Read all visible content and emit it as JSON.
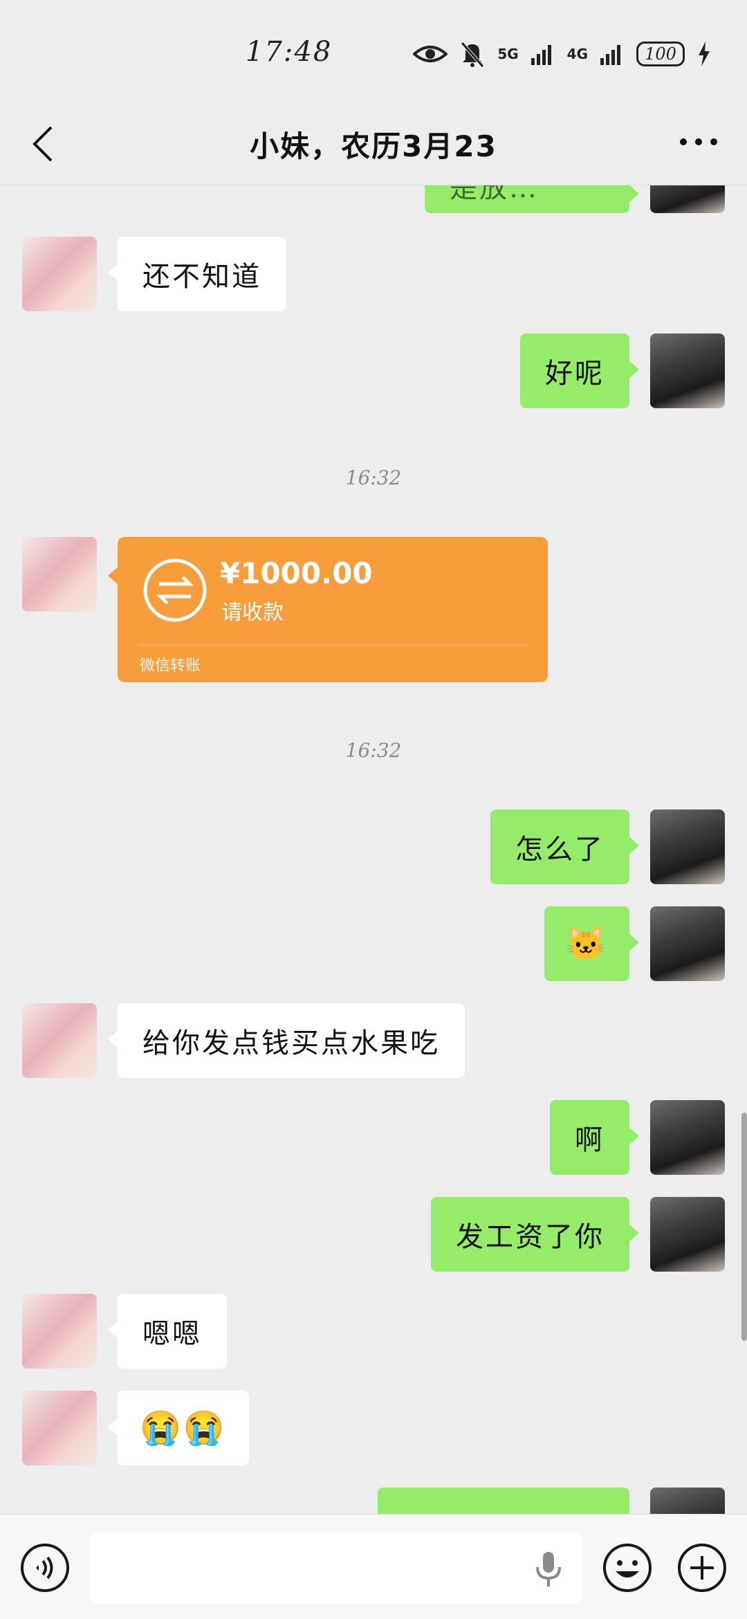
{
  "status_bar": {
    "time": "17:48",
    "network_1": "5G",
    "network_2": "4G",
    "battery": "100"
  },
  "header": {
    "title": "小妹，农历3月23",
    "back_icon": "chevron-left-icon",
    "more_icon": "more-dots-icon"
  },
  "messages": [
    {
      "side": "right",
      "text": "是放…",
      "partial": true
    },
    {
      "side": "left",
      "text": "还不知道"
    },
    {
      "side": "right",
      "text": "好呢"
    },
    {
      "type": "timestamp",
      "text": "16:32"
    },
    {
      "side": "left",
      "type": "transfer",
      "amount": "¥1000.00",
      "status": "请收款",
      "footer": "微信转账"
    },
    {
      "type": "timestamp",
      "text": "16:32"
    },
    {
      "side": "right",
      "text": "怎么了"
    },
    {
      "side": "right",
      "text": "🐱",
      "emoji": "smirk-dog-emoji"
    },
    {
      "side": "left",
      "text": "给你发点钱买点水果吃"
    },
    {
      "side": "right",
      "text": "啊"
    },
    {
      "side": "right",
      "text": "发工资了你"
    },
    {
      "side": "left",
      "text": "嗯嗯"
    },
    {
      "side": "left",
      "text": "😭😭",
      "emoji": "crying-emoji"
    },
    {
      "side": "right",
      "text": "",
      "partial": true
    }
  ],
  "input_bar": {
    "placeholder": "",
    "value": ""
  },
  "colors": {
    "background": "#ededed",
    "bubble_self": "#95ec69",
    "bubble_other": "#ffffff",
    "transfer": "#f89d3b"
  }
}
